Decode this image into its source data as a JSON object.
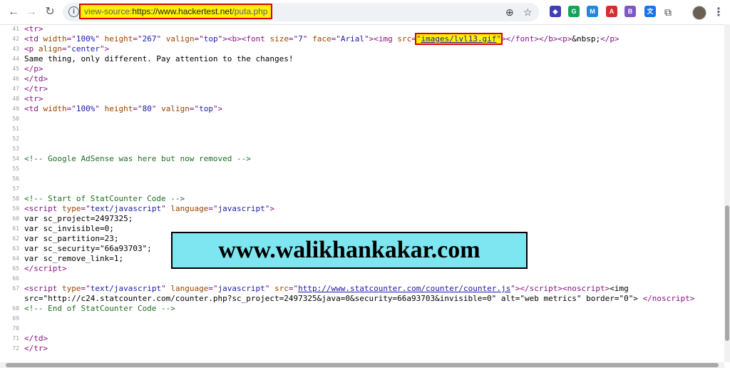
{
  "browser": {
    "back_icon": "back-arrow-icon",
    "forward_icon": "forward-arrow-icon",
    "reload_icon": "reload-icon",
    "url_scheme": "view-source:",
    "url_host": "https://www.hackertest.net",
    "url_path": "/puta.php",
    "highlight_color": "#fff200",
    "highlight_border": "#e00000",
    "extensions": [
      {
        "name": "shield-extension-icon",
        "color": "#3f3fb5",
        "glyph": "◆"
      },
      {
        "name": "grammarly-extension-icon",
        "color": "#15a35c",
        "glyph": "G"
      },
      {
        "name": "m-extension-icon",
        "color": "#1e88e5",
        "glyph": "M"
      },
      {
        "name": "pdf-extension-icon",
        "color": "#d32f2f",
        "glyph": "A"
      },
      {
        "name": "b-extension-icon",
        "color": "#7e57c2",
        "glyph": "B"
      },
      {
        "name": "translate-extension-icon",
        "color": "#1a73e8",
        "glyph": "文"
      }
    ]
  },
  "source": {
    "lines": [
      {
        "n": "41",
        "html": "<span class=\"t\">&lt;tr&gt;</span>"
      },
      {
        "n": "42",
        "html": "<span class=\"t\">&lt;td </span><span class=\"a\">width</span><span class=\"t\">=\"</span><span class=\"v\">100%</span><span class=\"t\">\" </span><span class=\"a\">height</span><span class=\"t\">=\"</span><span class=\"v\">267</span><span class=\"t\">\" </span><span class=\"a\">valign</span><span class=\"t\">=\"</span><span class=\"v\">top</span><span class=\"t\">\"&gt;&lt;b&gt;&lt;font </span><span class=\"a\">size</span><span class=\"t\">=\"</span><span class=\"v\">7</span><span class=\"t\">\" </span><span class=\"a\">face</span><span class=\"t\">=\"</span><span class=\"v\">Arial</span><span class=\"t\">\"&gt;&lt;img </span><span class=\"a\">src</span><span class=\"t\">=</span><span class=\"hl\"><span class=\"t\">\"</span><span class=\"lk\">images/lvl13.gif</span><span class=\"t\">\"</span></span><span class=\"t\">&gt;&lt;/font&gt;&lt;/b&gt;&lt;p&gt;</span>&amp;nbsp;<span class=\"t\">&lt;/p&gt;</span>"
      },
      {
        "n": "43",
        "html": "<span class=\"t\">&lt;p </span><span class=\"a\">align</span><span class=\"t\">=\"</span><span class=\"v\">center</span><span class=\"t\">\"&gt;</span>"
      },
      {
        "n": "44",
        "html": "Same thing, only different. Pay attention to the changes!"
      },
      {
        "n": "45",
        "html": "<span class=\"t\">&lt;/p&gt;</span>"
      },
      {
        "n": "46",
        "html": "<span class=\"t\">&lt;/td&gt;</span>"
      },
      {
        "n": "47",
        "html": "<span class=\"t\">&lt;/tr&gt;</span>"
      },
      {
        "n": "48",
        "html": "<span class=\"t\">&lt;tr&gt;</span>"
      },
      {
        "n": "49",
        "html": "<span class=\"t\">&lt;td </span><span class=\"a\">width</span><span class=\"t\">=\"</span><span class=\"v\">100%</span><span class=\"t\">\" </span><span class=\"a\">height</span><span class=\"t\">=\"</span><span class=\"v\">80</span><span class=\"t\">\" </span><span class=\"a\">valign</span><span class=\"t\">=\"</span><span class=\"v\">top</span><span class=\"t\">\"&gt;</span>"
      },
      {
        "n": "50",
        "html": ""
      },
      {
        "n": "51",
        "html": ""
      },
      {
        "n": "52",
        "html": ""
      },
      {
        "n": "53",
        "html": ""
      },
      {
        "n": "54",
        "html": "<span class=\"c\">&lt;!-- Google AdSense was here but now removed --&gt;</span>"
      },
      {
        "n": "55",
        "html": ""
      },
      {
        "n": "56",
        "html": ""
      },
      {
        "n": "57",
        "html": ""
      },
      {
        "n": "58",
        "html": "<span class=\"c\">&lt;!-- Start of StatCounter Code --&gt;</span>"
      },
      {
        "n": "59",
        "html": "<span class=\"t\">&lt;script </span><span class=\"a\">type</span><span class=\"t\">=\"</span><span class=\"v\">text/javascript</span><span class=\"t\">\" </span><span class=\"a\">language</span><span class=\"t\">=\"</span><span class=\"v\">javascript</span><span class=\"t\">\"&gt;</span>"
      },
      {
        "n": "60",
        "html": "var sc_project=2497325;"
      },
      {
        "n": "61",
        "html": "var sc_invisible=0;"
      },
      {
        "n": "62",
        "html": "var sc_partition=23;"
      },
      {
        "n": "63",
        "html": "var sc_security=\"66a93703\";"
      },
      {
        "n": "64",
        "html": "var sc_remove_link=1;"
      },
      {
        "n": "65",
        "html": "<span class=\"t\">&lt;/script&gt;</span>"
      },
      {
        "n": "66",
        "html": ""
      },
      {
        "n": "67",
        "html": "<span class=\"t\">&lt;script </span><span class=\"a\">type</span><span class=\"t\">=\"</span><span class=\"v\">text/javascript</span><span class=\"t\">\" </span><span class=\"a\">language</span><span class=\"t\">=\"</span><span class=\"v\">javascript</span><span class=\"t\">\" </span><span class=\"a\">src</span><span class=\"t\">=\"</span><span class=\"lk\">http://www.statcounter.com/counter/counter.js</span><span class=\"t\">\"&gt;&lt;/script&gt;&lt;noscript&gt;</span>&lt;img"
      },
      {
        "n": "",
        "html": "src=\"http://c24.statcounter.com/counter.php?sc_project=2497325&amp;java=0&amp;security=66a93703&amp;invisible=0\" alt=\"web metrics\" border=\"0\"&gt; <span class=\"t\">&lt;/noscript&gt;</span>"
      },
      {
        "n": "68",
        "html": "<span class=\"c\">&lt;!-- End of StatCounter Code --&gt;</span>"
      },
      {
        "n": "69",
        "html": ""
      },
      {
        "n": "70",
        "html": ""
      },
      {
        "n": "71",
        "html": "<span class=\"t\">&lt;/td&gt;</span>"
      },
      {
        "n": "72",
        "html": "<span class=\"t\">&lt;/tr&gt;</span>"
      }
    ]
  },
  "watermark": {
    "text": "www.walikhankakar.com",
    "bg_color": "#7ee6f0"
  }
}
